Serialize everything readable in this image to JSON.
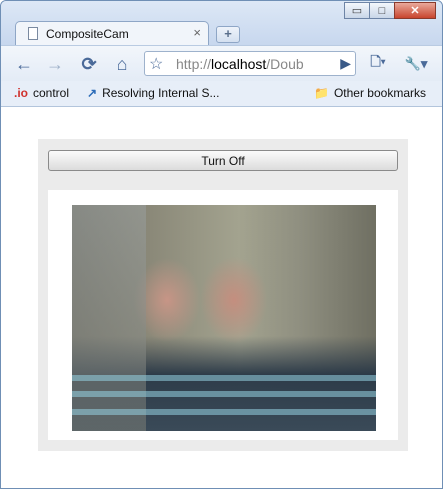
{
  "browser": {
    "tab_title": "CompositeCam",
    "tab_close": "×",
    "new_tab": "+",
    "window_buttons": {
      "minimize": "▭",
      "maximize": "□",
      "close": "✕"
    },
    "toolbar": {
      "back_icon": "←",
      "forward_icon": "→",
      "reload_icon": "⟳",
      "home_icon": "⌂",
      "star_icon": "☆",
      "url_scheme": "http://",
      "url_host": "localhost",
      "url_rest": "/Doub",
      "go_icon": "▶",
      "page_menu_icon": "🗋▾",
      "wrench_menu_icon": "🔧▾"
    },
    "bookmarks": [
      {
        "icon_text": ".io",
        "label": "control"
      },
      {
        "icon_text": "↗",
        "label": "Resolving Internal S..."
      }
    ],
    "other_bookmarks": {
      "icon_text": "📁",
      "label": "Other bookmarks"
    }
  },
  "page": {
    "turn_off_label": "Turn Off"
  }
}
